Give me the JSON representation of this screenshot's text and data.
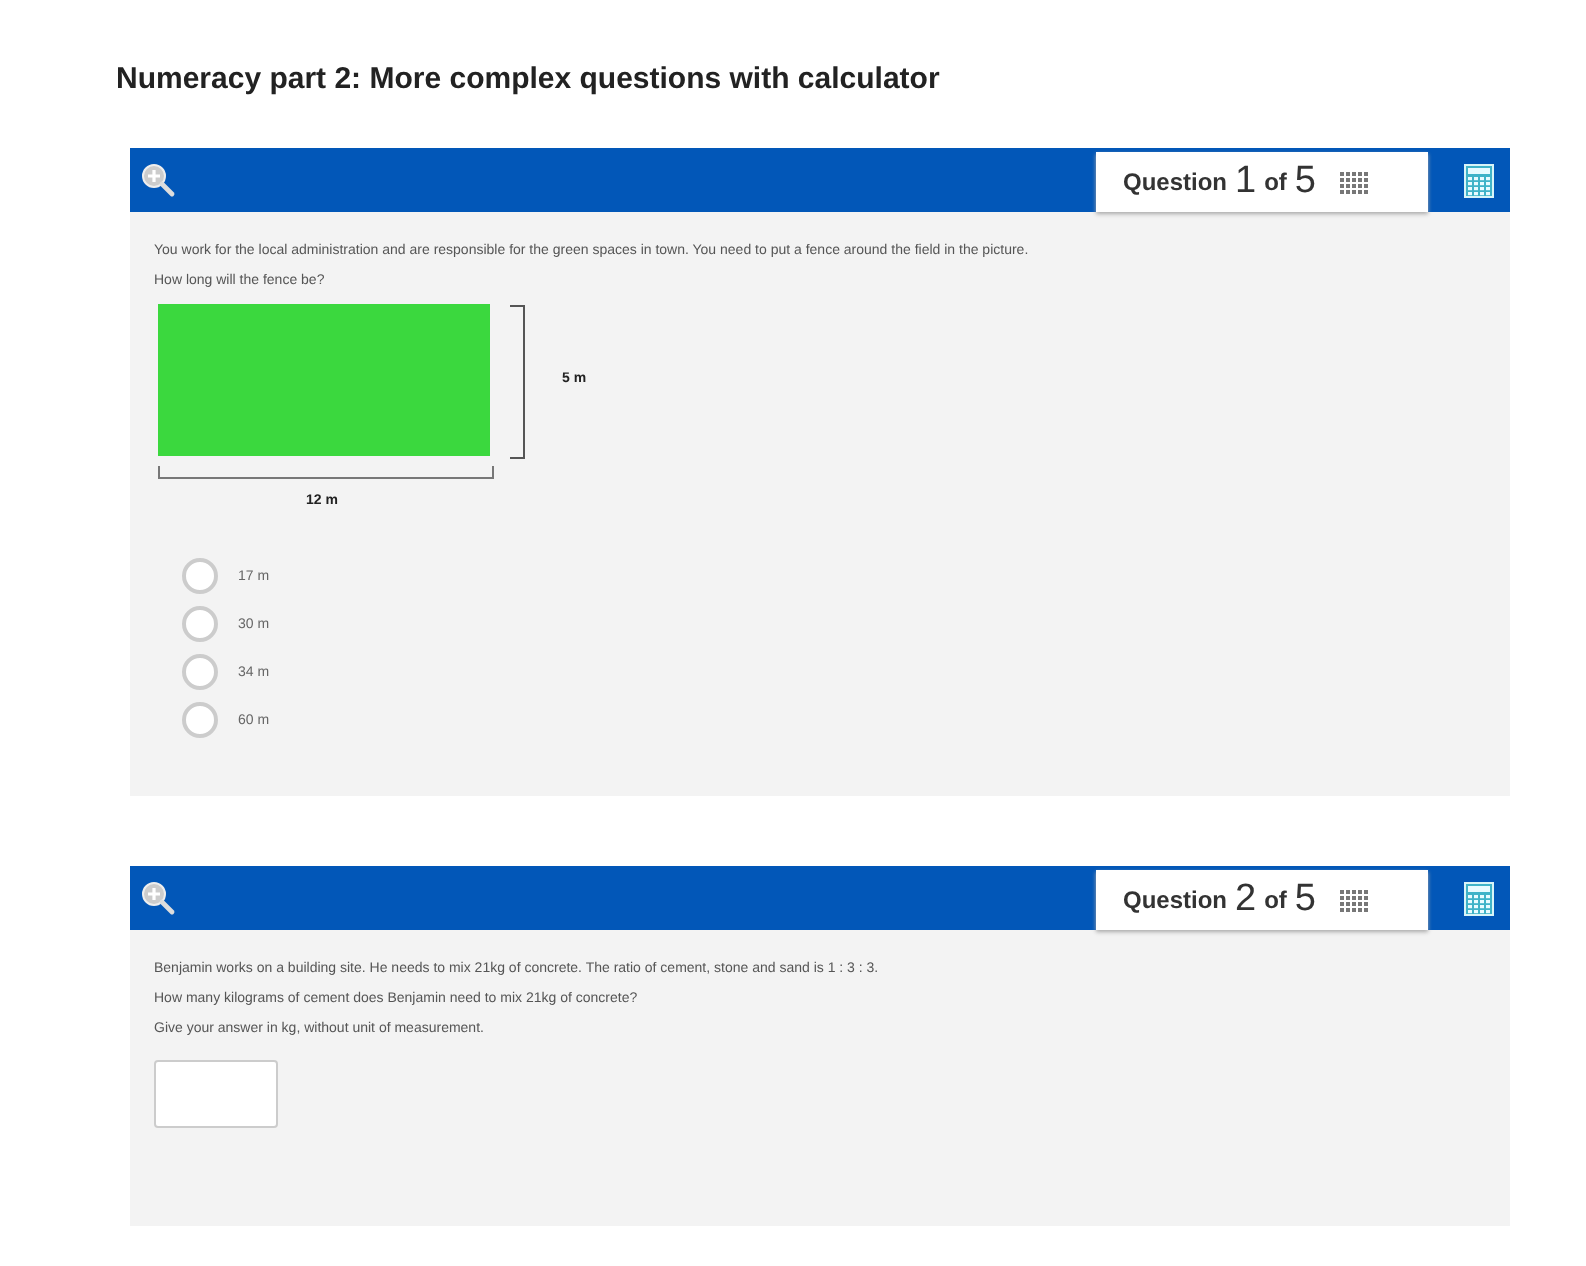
{
  "title": "Numeracy part 2: More complex questions with calculator",
  "questions": [
    {
      "kind": "multiple_choice",
      "counter": {
        "label": "Question",
        "number": "1",
        "of": "of",
        "total": "5"
      },
      "paragraphs": [
        "You work for the local administration and are responsible for the green spaces in town. You need to put a fence around the field in the picture.",
        "How long will the fence be?"
      ],
      "figure": {
        "width_label": "12 m",
        "height_label": "5 m"
      },
      "options": [
        {
          "label": "17 m",
          "selected": false
        },
        {
          "label": "30 m",
          "selected": false
        },
        {
          "label": "34 m",
          "selected": false
        },
        {
          "label": "60 m",
          "selected": false
        }
      ]
    },
    {
      "kind": "text_input",
      "counter": {
        "label": "Question",
        "number": "2",
        "of": "of",
        "total": "5"
      },
      "paragraphs": [
        "Benjamin works on a building site. He needs to mix 21kg of concrete. The ratio of cement, stone and sand is 1 : 3 : 3.",
        "How many kilograms of cement does Benjamin need to mix 21kg of concrete?",
        "Give your answer in kg, without unit of measurement."
      ]
    }
  ]
}
